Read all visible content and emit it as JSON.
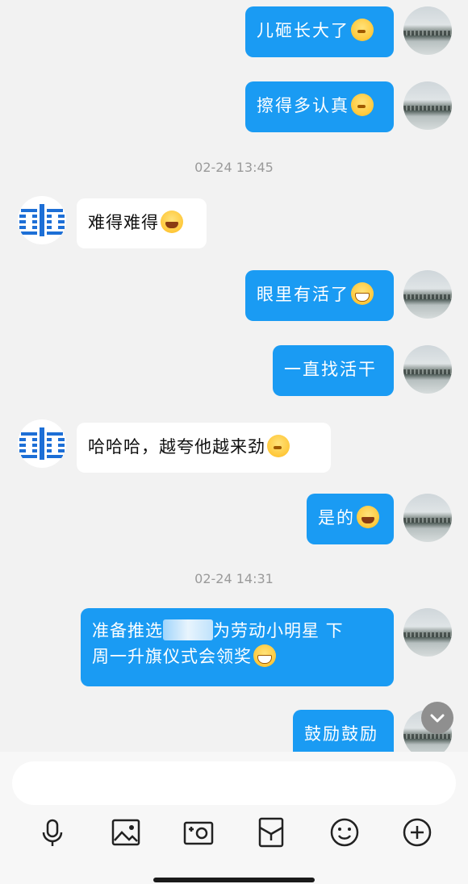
{
  "messages": [
    {
      "text": "儿砸长大了",
      "sender": "me",
      "emoji": "think"
    },
    {
      "text": "擦得多认真",
      "sender": "me",
      "emoji": "think"
    },
    {
      "text": "难得难得",
      "sender": "other",
      "emoji": "laugh"
    },
    {
      "text": "眼里有活了",
      "sender": "me",
      "emoji": "grin"
    },
    {
      "text": "一直找活干",
      "sender": "me",
      "emoji": ""
    },
    {
      "text": "哈哈哈，越夸他越来劲",
      "sender": "other",
      "emoji": "think"
    },
    {
      "text": "是的",
      "sender": "me",
      "emoji": "laugh"
    },
    {
      "line1_a": "准备推选",
      "line1_b": "为劳动小明星  下",
      "line2": "周一升旗仪式会领奖",
      "sender": "me",
      "emoji": "grin"
    },
    {
      "text": "鼓励鼓励",
      "sender": "me",
      "emoji": ""
    }
  ],
  "timestamps": [
    "02-24 13:45",
    "02-24 14:31"
  ],
  "input": {
    "value": "",
    "placeholder": ""
  },
  "toolbar": [
    "microphone-icon",
    "image-icon",
    "camera-icon",
    "red-packet-icon",
    "emoji-icon",
    "plus-icon"
  ],
  "colors": {
    "my_bubble": "#1a9bf3",
    "other_bubble": "#ffffff",
    "background": "#f2f2f2"
  }
}
